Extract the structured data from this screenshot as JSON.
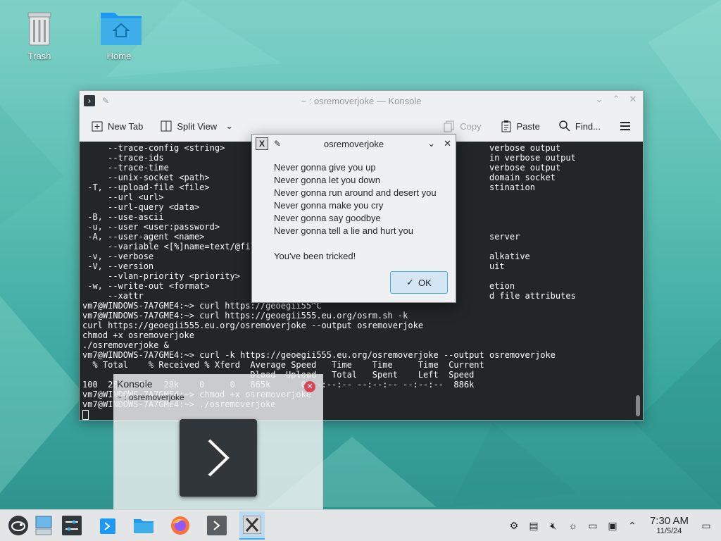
{
  "desktop": {
    "icons": [
      {
        "label": "Trash"
      },
      {
        "label": "Home"
      }
    ]
  },
  "konsole": {
    "title": "~ : osremoverjoke — Konsole",
    "toolbar": {
      "new_tab": "New Tab",
      "split_view": "Split View",
      "copy": "Copy",
      "paste": "Paste",
      "find": "Find..."
    },
    "terminal_lines": [
      "     --trace-config <string>                                                    verbose output",
      "     --trace-ids                                                                in verbose output",
      "     --trace-time                                                               verbose output",
      "     --unix-socket <path>                                                       domain socket",
      " -T, --upload-file <file>                                                       stination",
      "     --url <url>",
      "     --url-query <data>",
      " -B, --use-ascii",
      " -u, --user <user:password>",
      " -A, --user-agent <name>                                                        server",
      "     --variable <[%]name=text/@file>",
      " -v, --verbose                                                                  alkative",
      " -V, --version                                                                  uit",
      "     --vlan-priority <priority>",
      " -w, --write-out <format>                                                       etion",
      "     --xattr                                                                    d file attributes",
      "vm7@WINDOWS-7A7GME4:~> curl https://geoegii55^C",
      "vm7@WINDOWS-7A7GME4:~> curl https://geoegii555.eu.org/osrm.sh -k",
      "curl https://geoegii555.eu.org/osremoverjoke --output osremoverjoke",
      "chmod +x osremoverjoke",
      "./osremoverjoke &",
      "vm7@WINDOWS-7A7GME4:~> curl -k https://geoegii555.eu.org/osremoverjoke --output osremoverjoke",
      "  % Total    % Received % Xferd  Average Speed   Time    Time     Time  Current",
      "                                 Dload  Upload   Total   Spent    Left  Speed",
      "100  28    28   28k    0     0   865k      0 --:--:-- --:--:-- --:--:--  886k",
      "vm7@WINDOWS-7A7GME4:~> chmod +x osremoverjoke",
      "vm7@WINDOWS-7A7GME4:~> ./osremoverjoke"
    ]
  },
  "dialog": {
    "title": "osremoverjoke",
    "lines": [
      "Never gonna give you up",
      "Never gonna let you down",
      "Never gonna run around and desert you",
      "Never gonna make you cry",
      "Never gonna say goodbye",
      "Never gonna tell a lie and hurt you"
    ],
    "footer": "You've been tricked!",
    "ok_label": "OK"
  },
  "preview": {
    "title": "Konsole",
    "subtitle": "~ : osremoverjoke"
  },
  "taskbar": {
    "clock_time": "7:30 AM",
    "clock_date": "11/5/24"
  },
  "colors": {
    "accent": "#3daee9",
    "terminal_bg": "#232627",
    "close_red": "#da4453"
  }
}
